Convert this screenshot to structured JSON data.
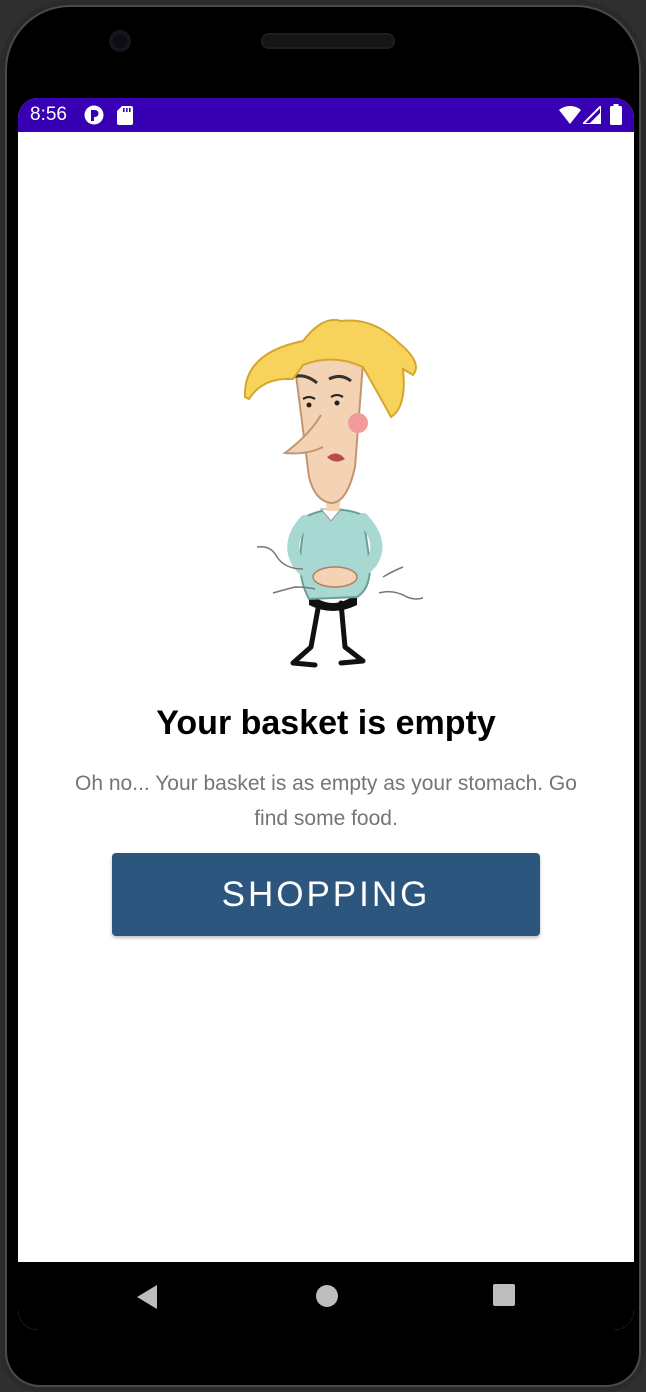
{
  "status_bar": {
    "time": "8:56",
    "left_icons": [
      "notification-icon",
      "sd-card-icon"
    ],
    "right_icons": [
      "wifi-icon",
      "signal-icon",
      "battery-icon"
    ],
    "background_color": "#3700b3"
  },
  "empty_state": {
    "illustration": "hungry-man-illustration",
    "title": "Your basket is empty",
    "message": "Oh no... Your basket is as empty as your stomach. Go find some food.",
    "button_label": "SHOPPING",
    "button_color": "#2c567e"
  },
  "nav_bar": {
    "buttons": [
      "back-icon",
      "home-icon",
      "recents-icon"
    ]
  }
}
